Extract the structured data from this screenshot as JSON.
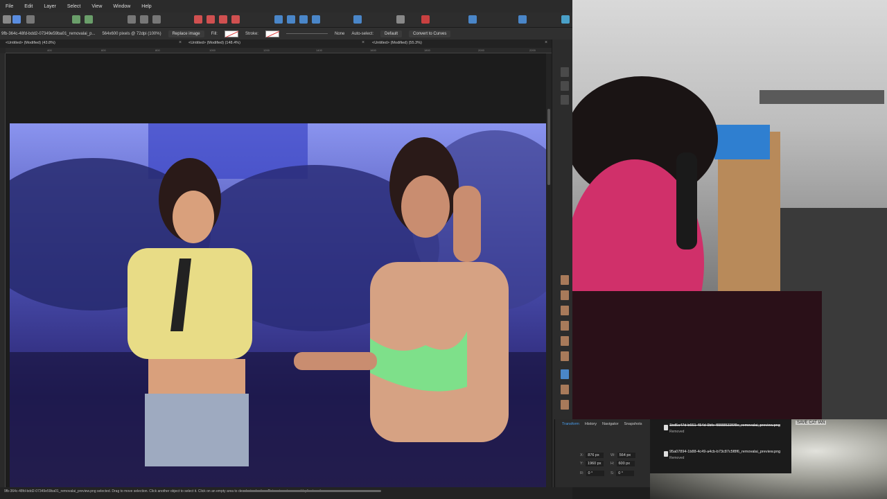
{
  "menu": [
    "File",
    "Edit",
    "Layer",
    "Select",
    "View",
    "Window",
    "Help"
  ],
  "context": {
    "filename": "9fb-364c-48fd-bdd2-07349e59ba01_removalai_p...",
    "dimensions": "564x600 pixels @ 72dpi (100%)",
    "replace_image": "Replace image",
    "fill_label": "Fill:",
    "stroke_label": "Stroke:",
    "stroke_value": "None",
    "auto_select_label": "Auto-select:",
    "auto_select_value": "Default",
    "convert": "Convert to Curves"
  },
  "tabs": [
    {
      "label": "<Untitled> (Modified) (43.8%)",
      "close": "×"
    },
    {
      "label": "<Untitled> (Modified) (148.4%)",
      "close": "×"
    },
    {
      "label": "<Untitled> (Modified) (55.3%)",
      "close": "×"
    }
  ],
  "ruler": [
    "400",
    "600",
    "800",
    "1000",
    "1200",
    "1400",
    "1600",
    "1800",
    "2000",
    "2200"
  ],
  "transform": {
    "tabs": [
      "Transform",
      "History",
      "Navigator",
      "Snapshots"
    ],
    "x_label": "X:",
    "x_value": "876 px",
    "y_label": "Y:",
    "y_value": "1960 px",
    "w_label": "W:",
    "w_value": "564 px",
    "h_label": "H:",
    "h_value": "600 px",
    "r_label": "R:",
    "r_value": "0 °",
    "s_label": "S:",
    "s_value": "0 °"
  },
  "exports": [
    {
      "name": "1bd5a47d-b661-454d-9bfe-f88885336f8e_removalai_preview.png",
      "state": "Removed",
      "strikethrough": true
    },
    {
      "name": "95a07894-1b88-4c49-a4cb-b73c87c5f8f6_removalai_preview.png",
      "state": "Removed",
      "strikethrough": false
    }
  ],
  "overlay_label": "SAVE CAT IAN",
  "status": "9fb-364c-48fd-bdd2-07349e59ba01_removalai_preview.png selected. Drag to move selection. Click another object to select it. Click on an empty area to deselect selection. Return to enter move/duplicate values."
}
